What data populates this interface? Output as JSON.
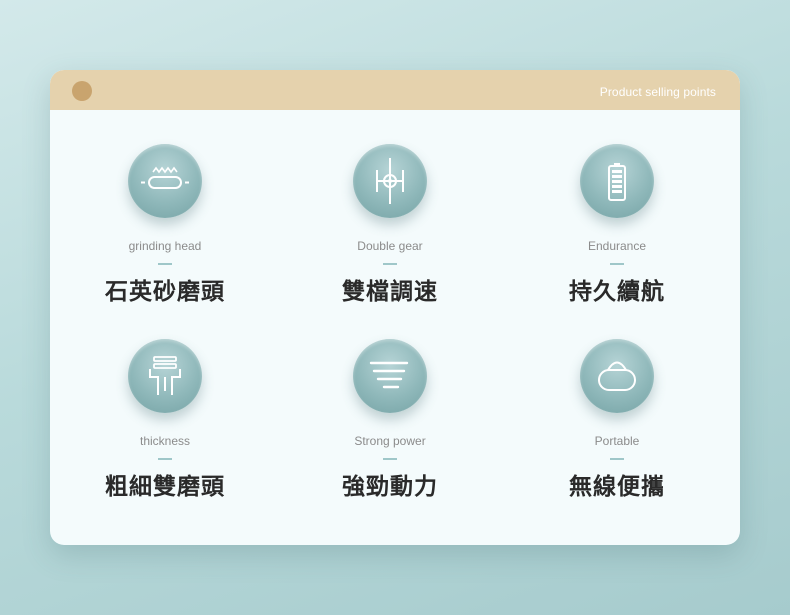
{
  "header": {
    "title": "Product selling points"
  },
  "features": [
    {
      "en": "grinding head",
      "zh": "石英砂磨頭",
      "icon": "grinding-head-icon"
    },
    {
      "en": "Double gear",
      "zh": "雙檔調速",
      "icon": "double-gear-icon"
    },
    {
      "en": "Endurance",
      "zh": "持久續航",
      "icon": "battery-icon"
    },
    {
      "en": "thickness",
      "zh": "粗細雙磨頭",
      "icon": "thickness-icon"
    },
    {
      "en": "Strong power",
      "zh": "強勁動力",
      "icon": "power-lines-icon"
    },
    {
      "en": "Portable",
      "zh": "無線便攜",
      "icon": "bag-icon"
    }
  ],
  "colors": {
    "header_band": "#e5d2ad",
    "header_dot": "#c9a46e",
    "icon_circle": "#8fb8ba",
    "card": "#f4fbfc"
  }
}
